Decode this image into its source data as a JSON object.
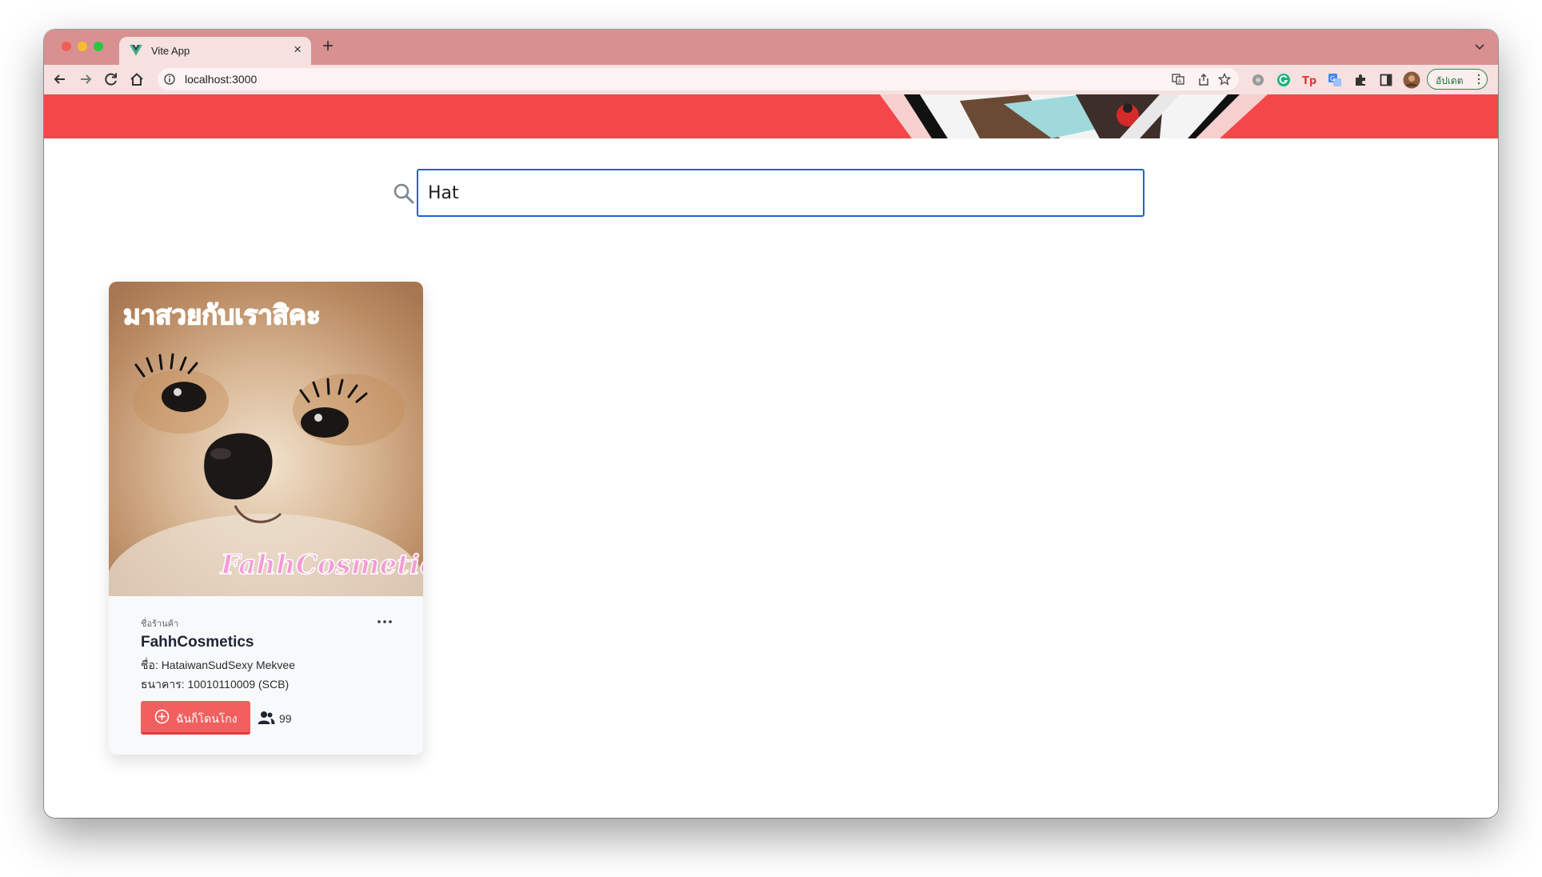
{
  "browser": {
    "tab_title": "Vite App",
    "new_tab_label": "+",
    "close_tab_label": "×",
    "url": "localhost:3000",
    "update_button_label": "อัปเดต",
    "frame_color": "#d99090"
  },
  "banner": {
    "color": "#f3474a"
  },
  "search": {
    "value": "Hat"
  },
  "card": {
    "image_top_text": "มาสวยกับเราสิคะ",
    "image_watermark": "FahhCosmetics",
    "caption": "ชื่อร้านค้า",
    "title": "FahhCosmetics",
    "owner": "ชื่อ: HataiwanSudSexy Mekvee",
    "bank": "ธนาคาร: 10010110009 (SCB)",
    "join_button_label": "ฉันก็โดนโกง",
    "members_count": "99",
    "accent_color": "#f25f5f"
  }
}
